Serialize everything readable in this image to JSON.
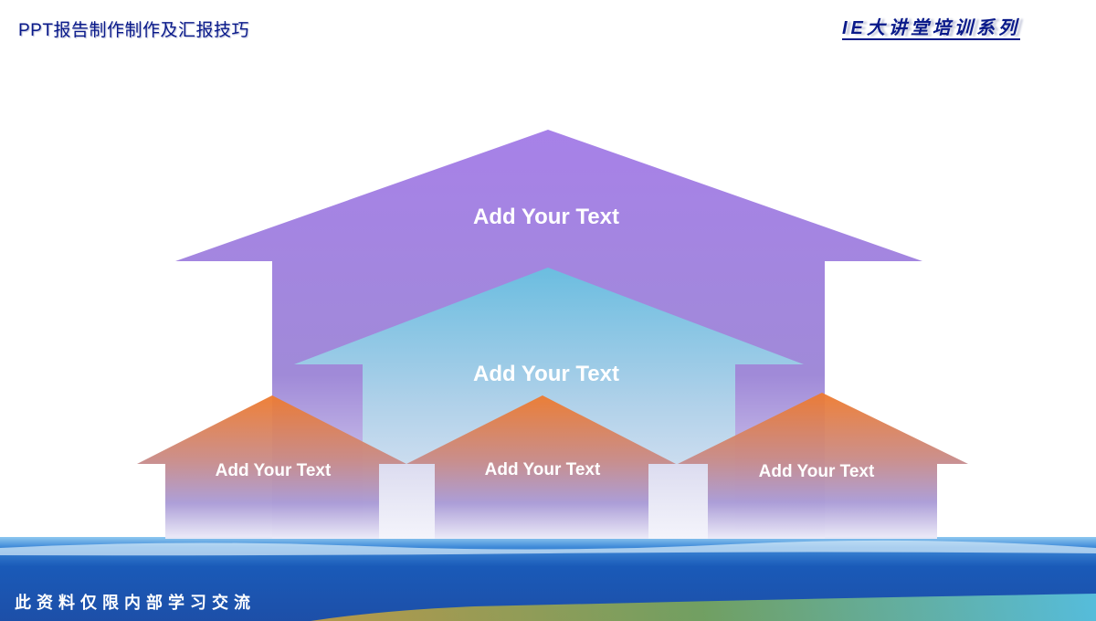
{
  "header": {
    "title": "PPT报告制作制作及汇报技巧",
    "series": "IE大讲堂培训系列"
  },
  "diagram": {
    "arrows": [
      {
        "label": "Add Your Text",
        "color": "#9b7fe0"
      },
      {
        "label": "Add Your Text",
        "color": "#6cc4e0"
      },
      {
        "label": "Add Your Text",
        "color": "#ee7d35"
      },
      {
        "label": "Add Your Text",
        "color": "#ee7d35"
      },
      {
        "label": "Add Your Text",
        "color": "#ee7d35"
      }
    ]
  },
  "footer": {
    "note": "此资料仅限内部学习交流"
  }
}
